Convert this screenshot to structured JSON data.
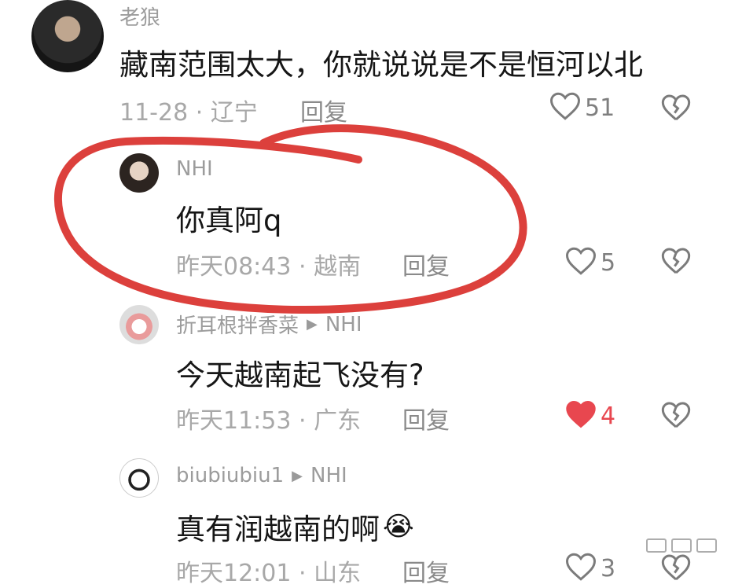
{
  "comments": [
    {
      "author": "老狼",
      "text": "藏南范围太大，你就说说是不是恒河以北",
      "meta": "11-28 · 辽宁",
      "reply_label": "回复",
      "likes": "51",
      "liked": false
    },
    {
      "author": "NHI",
      "text": "你真阿q",
      "meta": "昨天08:43 · 越南",
      "reply_label": "回复",
      "likes": "5",
      "liked": false
    },
    {
      "author": "折耳根拌香菜",
      "reply_to": "NHI",
      "text": "今天越南起飞没有?",
      "meta": "昨天11:53 · 广东",
      "reply_label": "回复",
      "likes": "4",
      "liked": true
    },
    {
      "author": "biubiubiu1",
      "reply_to": "NHI",
      "text": "真有润越南的啊",
      "emoji": "😭",
      "meta": "昨天12:01 · 山东",
      "reply_label": "回复",
      "likes": "3",
      "liked": false
    }
  ],
  "colors": {
    "annotation_circle": "#d9302b",
    "liked_heart": "#e8474f",
    "muted_text": "#a8a8a8"
  },
  "icons": {
    "like": "heart-outline-icon",
    "liked": "heart-filled-icon",
    "dislike": "broken-heart-icon",
    "reply_arrow": "play-arrow-icon"
  }
}
